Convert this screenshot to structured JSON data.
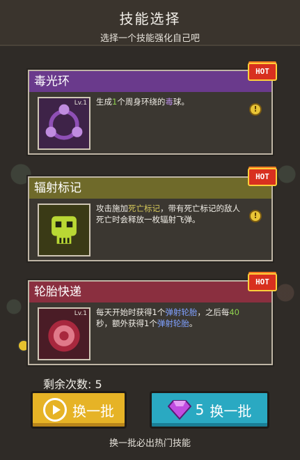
{
  "header": {
    "title": "技能选择",
    "subtitle": "选择一个技能强化自己吧"
  },
  "colors": {
    "card1_bar": "#6a3a8c",
    "card2_bar": "#6f6a2a",
    "card3_bar": "#8a2f3f",
    "yellow_button": "#e6b326",
    "blue_button": "#2aa9c2"
  },
  "cards": [
    {
      "name": "毒光环",
      "level": "Lv.1",
      "hot": "HOT",
      "icon": "poison-orbs-icon",
      "desc_parts": [
        "生成",
        "1",
        "个周身环绕的",
        "毒",
        "球。"
      ]
    },
    {
      "name": "辐射标记",
      "level": "",
      "hot": "HOT",
      "icon": "skull-icon",
      "desc_parts": [
        "攻击施加",
        "死亡标记",
        "，带有死亡标记的敌人死亡时会释放一枚辐射飞弹。"
      ]
    },
    {
      "name": "轮胎快递",
      "level": "Lv.1",
      "hot": "HOT",
      "icon": "tire-icon",
      "desc_parts": [
        "每天开始时获得1个",
        "弹射轮胎",
        "，之后每",
        "40",
        "秒，额外获得1个",
        "弹射轮胎",
        "。"
      ]
    }
  ],
  "remaining": "剩余次数: 5",
  "buttons": {
    "refresh_label": "换一批",
    "refresh_icon": "play-circle-icon",
    "gem_refresh_label": "换一批",
    "gem_count": "5",
    "gem_icon": "purple-gem-icon"
  },
  "footer": "换一批必出热门技能"
}
